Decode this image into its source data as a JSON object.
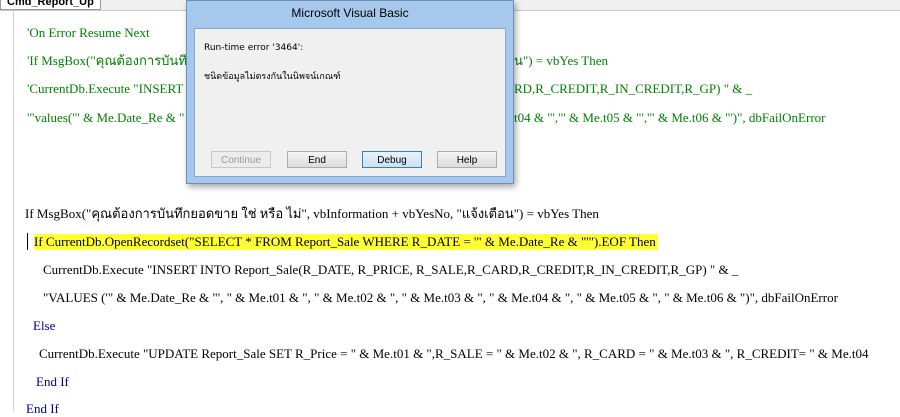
{
  "procedure_box": "Cmd_Report_Up",
  "code_lines": [
    {
      "text": "'On Error Resume Next",
      "kind": "comment"
    },
    {
      "text": "'If MsgBox(\"คุณต้องการบันทึ",
      "kind": "comment"
    },
    {
      "text": "'CurrentDb.Execute \"INSERT",
      "kind": "comment"
    },
    {
      "text": "'\"values('\" & Me.Date_Re & \"",
      "kind": "comment"
    },
    {
      "text": "If MsgBox(\"คุณต้องการบันทึกยอดขาย ใช่ หรือ ไม่\", vbInformation + vbYesNo, \"แจ้งเตือน\") = vbYes Then",
      "kind": "normal"
    },
    {
      "text": "If CurrentDb.OpenRecordset(\"SELECT * FROM Report_Sale WHERE R_DATE = '\" & Me.Date_Re & \"'\").EOF Then",
      "kind": "highlight"
    },
    {
      "text": "CurrentDb.Execute \"INSERT INTO Report_Sale(R_DATE, R_PRICE, R_SALE,R_CARD,R_CREDIT,R_IN_CREDIT,R_GP) \" & _",
      "kind": "normal"
    },
    {
      "text": "\"VALUES ('\" & Me.Date_Re & \"', \" & Me.t01 & \", \" & Me.t02 & \", \" & Me.t03 & \", \" & Me.t04 & \", \" & Me.t05 & \", \" & Me.t06 & \")\", dbFailOnError",
      "kind": "normal"
    },
    {
      "text": "Else",
      "kind": "kw"
    },
    {
      "text": "CurrentDb.Execute \"UPDATE Report_Sale SET R_Price = \" & Me.t01 & \",R_SALE = \" & Me.t02 & \", R_CARD = \" & Me.t03 & \", R_CREDIT= \" & Me.t04",
      "kind": "normal"
    },
    {
      "text": "End If",
      "kind": "kw"
    },
    {
      "text": "End If",
      "kind": "kw"
    }
  ],
  "right_fragments": [
    {
      "text": "น\") = vbYes Then",
      "kind": "comment"
    },
    {
      "text": "RD,R_CREDIT,R_IN_CREDIT,R_GP) \" & _",
      "kind": "comment"
    },
    {
      "text": "t04 & \"','\" & Me.t05 & \"','\" & Me.t06 & \"')\", dbFailOnError",
      "kind": "comment"
    }
  ],
  "dialog": {
    "title": "Microsoft Visual Basic",
    "error_title": "Run-time error '3464':",
    "error_message": "ชนิดข้อมูลไม่ตรงกันในนิพจน์เกณฑ์",
    "buttons": {
      "continue": "Continue",
      "end": "End",
      "debug": "Debug",
      "help": "Help"
    }
  }
}
